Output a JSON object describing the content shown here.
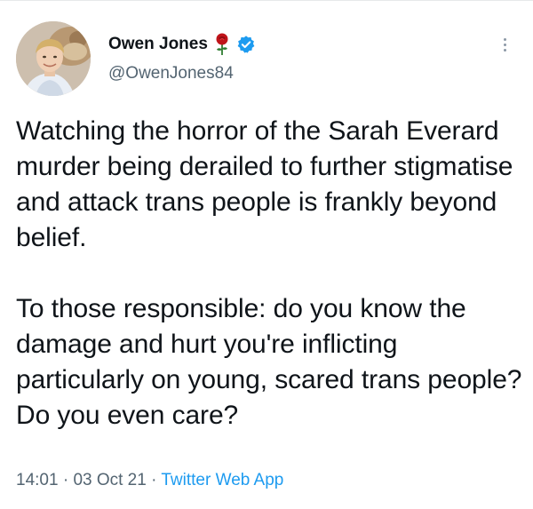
{
  "author": {
    "display_name": "Owen Jones",
    "handle": "@OwenJones84",
    "verified": true,
    "badge_emoji_icon": "rose-icon",
    "verified_icon": "verified-badge-icon",
    "verified_color": "#1d9bf0"
  },
  "tweet": {
    "paragraph_1": "Watching the horror of the Sarah Everard murder being derailed to further stigmatise and attack trans people is frankly beyond belief.",
    "paragraph_2": "To those responsible: do you know the damage and hurt you're inflicting particularly on young, scared trans people? Do you even care?"
  },
  "meta": {
    "time": "14:01",
    "separator": " · ",
    "date": "03 Oct 21",
    "source": "Twitter Web App"
  },
  "colors": {
    "text": "#0f1419",
    "secondary": "#536471",
    "link": "#1d9bf0"
  }
}
